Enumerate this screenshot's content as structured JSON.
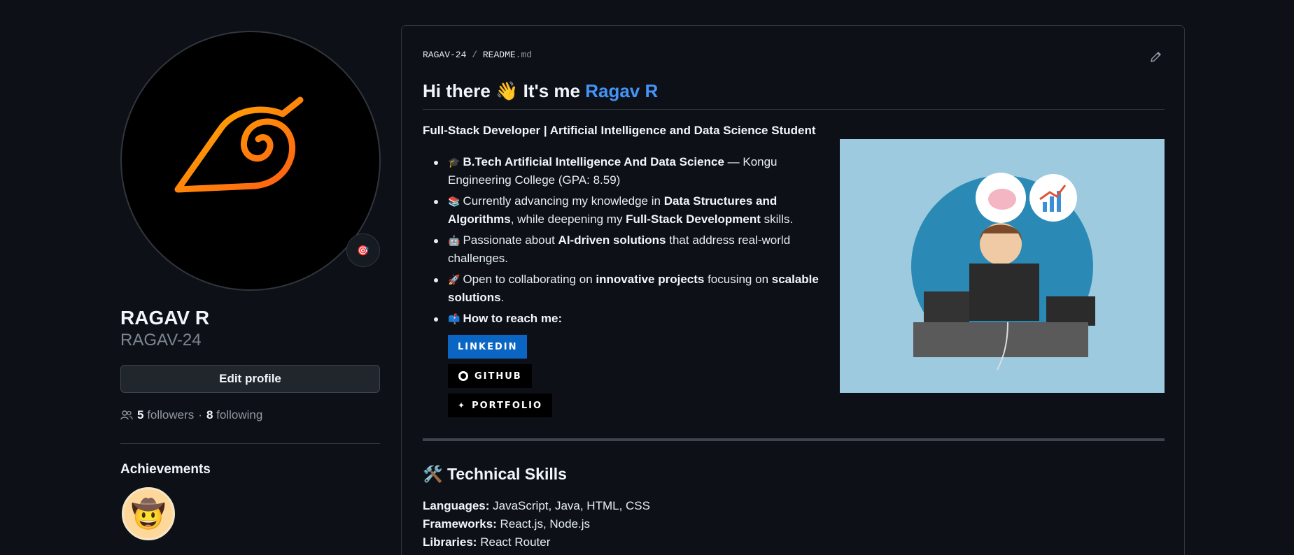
{
  "profile": {
    "full_name": "RAGAV R",
    "username": "RAGAV-24",
    "edit_profile_label": "Edit profile",
    "followers_count": "5",
    "followers_label": "followers",
    "following_count": "8",
    "following_label": "following",
    "separator": "·",
    "status_icon": "target-emoji",
    "avatar_icon": "leaf-village-swirl-logo"
  },
  "achievements": {
    "title": "Achievements",
    "badge_icon": "cowboy-emoji"
  },
  "readme": {
    "path_owner": "RAGAV-24",
    "path_sep": "/",
    "path_file": "README",
    "path_ext": ".md",
    "heading_prefix": "Hi there",
    "heading_wave": "👋",
    "heading_middle": "It's me",
    "heading_name": "Ragav R",
    "subtitle": "Full-Stack Developer | Artificial Intelligence and Data Science Student",
    "items": {
      "edu_emoji": "🎓",
      "edu_bold": "B.Tech Artificial Intelligence And Data Science",
      "edu_rest": " — Kongu Engineering College (GPA: 8.59)",
      "learn_emoji": "📚",
      "learn_a": "Currently advancing my knowledge in ",
      "learn_bold1": "Data Structures and Algorithms",
      "learn_b": ", while deepening my ",
      "learn_bold2": "Full-Stack Development",
      "learn_c": " skills.",
      "ai_emoji": "🤖",
      "ai_a": "Passionate about ",
      "ai_bold": "AI-driven solutions",
      "ai_b": " that address real-world challenges.",
      "collab_emoji": "🚀",
      "collab_a": "Open to collaborating on ",
      "collab_bold1": "innovative projects",
      "collab_b": " focusing on ",
      "collab_bold2": "scalable solutions",
      "collab_c": ".",
      "reach_emoji": "📫",
      "reach_bold": "How to reach me:"
    },
    "badges": {
      "linkedin": "LINKEDIN",
      "github": "GITHUB",
      "portfolio": "PORTFOLIO"
    },
    "skills_heading_emoji": "🛠️",
    "skills_heading": "Technical Skills",
    "skills": {
      "languages_label": "Languages:",
      "languages": " JavaScript, Java, HTML, CSS",
      "frameworks_label": "Frameworks:",
      "frameworks": " React.js, Node.js",
      "libraries_label": "Libraries:",
      "libraries": " React Router"
    }
  },
  "colors": {
    "background": "#0d1117",
    "accent_link": "#4493f8",
    "linkedin_blue": "#0a66c2",
    "illustration_bg": "#9ecadf"
  }
}
